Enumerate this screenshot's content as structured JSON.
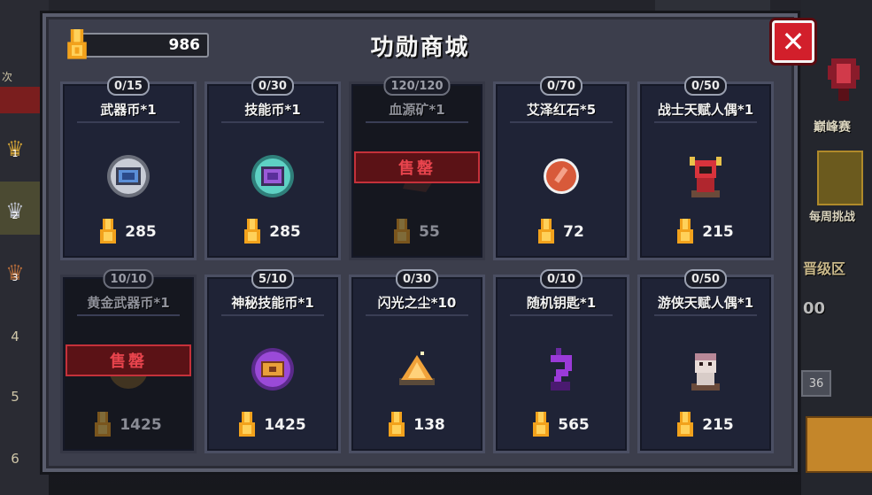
{
  "header": {
    "title": "功勋商城",
    "balance": "986",
    "close_label": "✕"
  },
  "background": {
    "left_ranks": [
      "1",
      "2",
      "3",
      "4",
      "5",
      "6"
    ],
    "left_partial": "次",
    "right_labels": {
      "peak": "巅峰赛",
      "weekly": "每周挑战",
      "promotion": "晋级区",
      "box_value": "36",
      "value_partial": "00"
    }
  },
  "items": [
    {
      "qty": "0/15",
      "name": "武器币*1",
      "price": "285",
      "sold_out": false,
      "icon": "weapon-coin-icon"
    },
    {
      "qty": "0/30",
      "name": "技能币*1",
      "price": "285",
      "sold_out": false,
      "icon": "skill-coin-icon"
    },
    {
      "qty": "120/120",
      "name": "血源矿*1",
      "price": "55",
      "sold_out": true,
      "icon": "blood-ore-icon"
    },
    {
      "qty": "0/70",
      "name": "艾泽红石*5",
      "price": "72",
      "sold_out": false,
      "icon": "red-stone-icon"
    },
    {
      "qty": "0/50",
      "name": "战士天赋人偶*1",
      "price": "215",
      "sold_out": false,
      "icon": "warrior-doll-icon"
    },
    {
      "qty": "10/10",
      "name": "黄金武器币*1",
      "price": "1425",
      "sold_out": true,
      "icon": "gold-weapon-coin-icon"
    },
    {
      "qty": "5/10",
      "name": "神秘技能币*1",
      "price": "1425",
      "sold_out": false,
      "icon": "mystery-skill-coin-icon"
    },
    {
      "qty": "0/30",
      "name": "闪光之尘*10",
      "price": "138",
      "sold_out": false,
      "icon": "flash-dust-icon"
    },
    {
      "qty": "0/10",
      "name": "随机钥匙*1",
      "price": "565",
      "sold_out": false,
      "icon": "random-key-icon"
    },
    {
      "qty": "0/50",
      "name": "游侠天赋人偶*1",
      "price": "215",
      "sold_out": false,
      "icon": "ranger-doll-icon"
    }
  ],
  "sold_out_label": "售罄",
  "colors": {
    "close_button": "#d21f2b",
    "sold_out": "#c5313a",
    "card_bg": "#1f2336",
    "modal_bg": "#3c3e4c"
  }
}
